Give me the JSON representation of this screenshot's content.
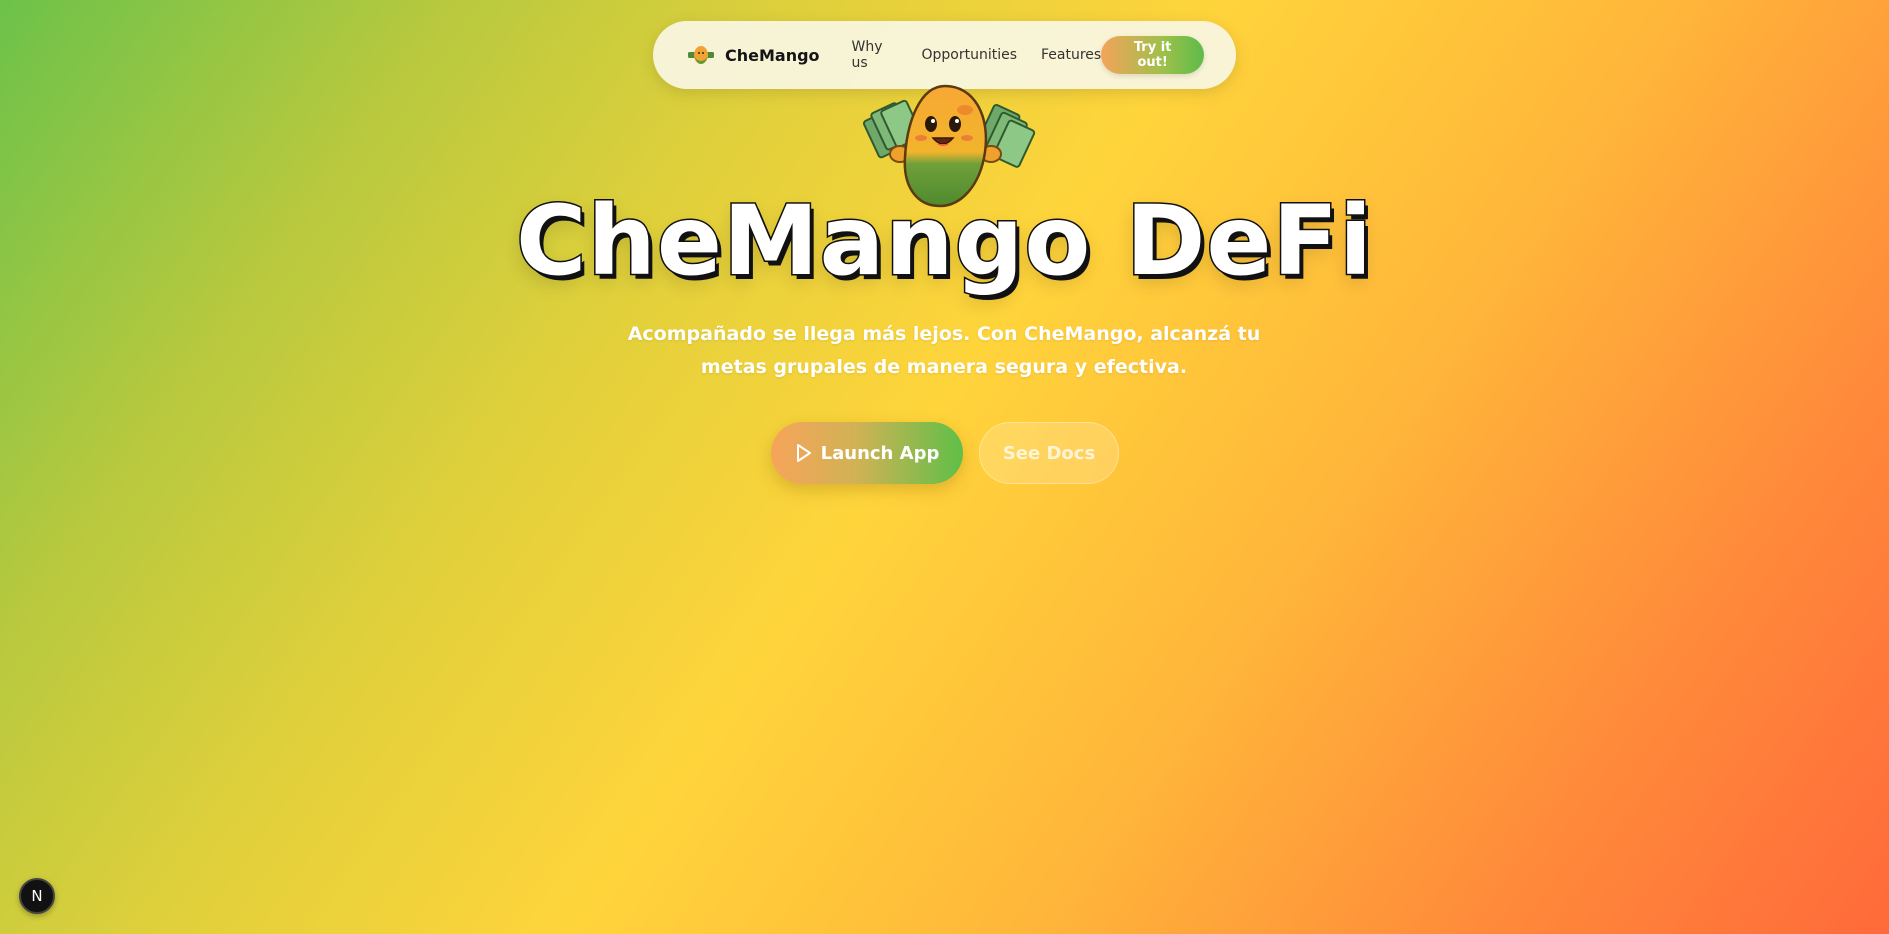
{
  "nav": {
    "brand": "CheMango",
    "links": [
      "Why us",
      "Opportunities",
      "Features"
    ],
    "cta": "Try it out!"
  },
  "hero": {
    "title": "CheMango DeFi",
    "subtitle": "Acompañado se llega más lejos. Con CheMango, alcanzá tu metas grupales de manera segura y efectiva.",
    "primary_button": "Launch App",
    "secondary_button": "See Docs"
  },
  "dev_badge": "N",
  "colors": {
    "background_start": "#6cc24a",
    "background_mid": "#ffd43b",
    "background_end": "#ff6a3a",
    "accent_orange": "#f7a45a",
    "accent_green": "#5fbf48"
  },
  "icons": {
    "logo": "mango-mascot-icon",
    "launch": "play-icon"
  }
}
